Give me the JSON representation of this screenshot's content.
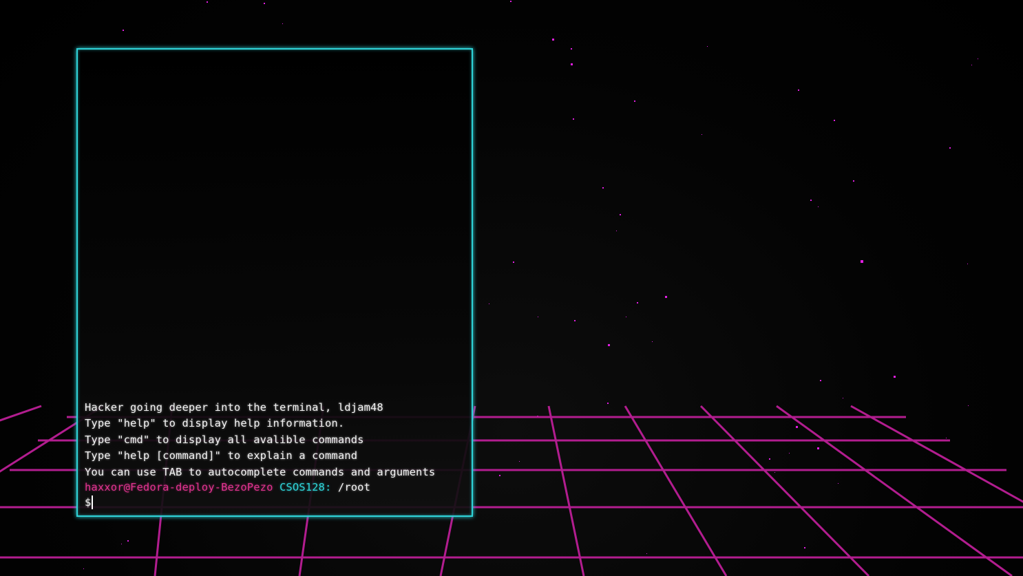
{
  "terminal": {
    "welcome_lines": [
      "Hacker going deeper into the terminal, ldjam48",
      "Type \"help\" to display help information.",
      "Type \"cmd\" to display all avalible commands",
      "Type \"help [command]\" to explain a command",
      "You can use TAB to autocomplete commands and arguments"
    ],
    "prompt": {
      "user_host": "haxxor@Fedora-deploy-BezoPezo",
      "os": "CSOS128:",
      "path": "/root",
      "symbol": "$",
      "input_value": ""
    }
  },
  "colors": {
    "frame": "#2fd3d8",
    "grid": "#b21d8f",
    "stars": "#e01ee0",
    "user_host": "#e0338f",
    "os": "#2fd3d8",
    "text": "#f2f2f2"
  }
}
